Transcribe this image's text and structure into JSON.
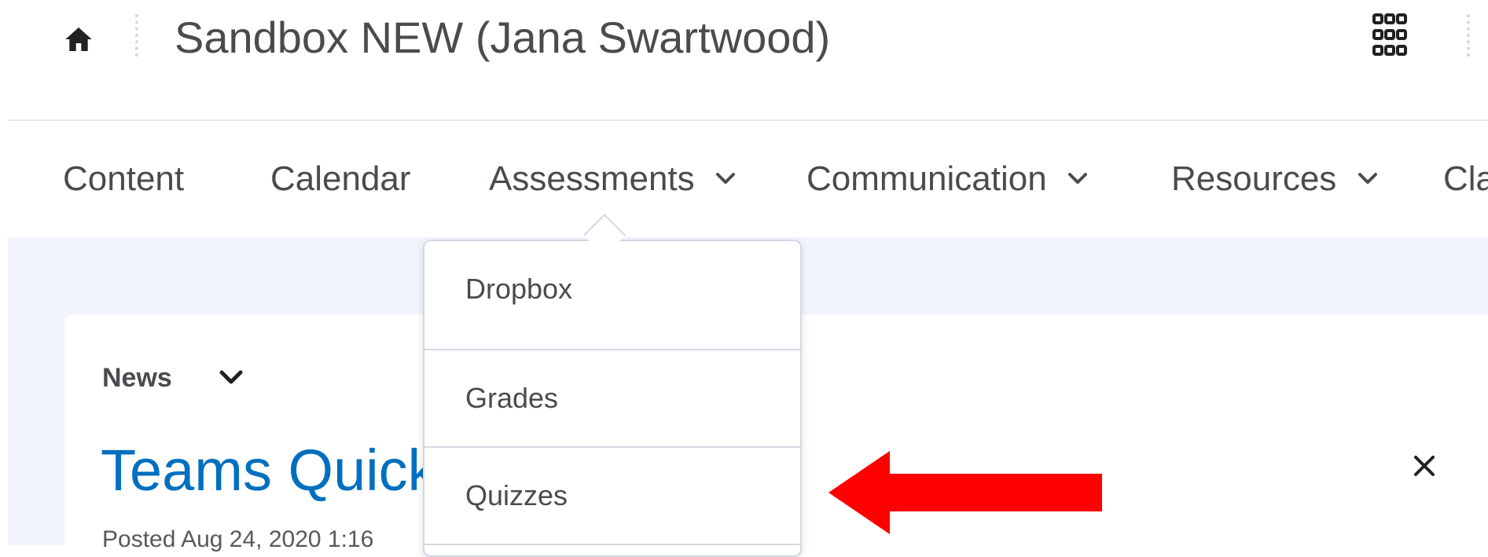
{
  "header": {
    "home_icon": "home-icon",
    "title": "Sandbox NEW (Jana Swartwood)",
    "apps_icon": "grid-icon"
  },
  "nav": {
    "items": [
      {
        "label": "Content",
        "has_chevron": false
      },
      {
        "label": "Calendar",
        "has_chevron": false
      },
      {
        "label": "Assessments",
        "has_chevron": true
      },
      {
        "label": "Communication",
        "has_chevron": true
      },
      {
        "label": "Resources",
        "has_chevron": true
      },
      {
        "label": "Cla",
        "has_chevron": false
      }
    ],
    "chevron_icon": "chevron-down-icon"
  },
  "dropdown": {
    "items": [
      {
        "label": "Dropbox"
      },
      {
        "label": "Grades"
      },
      {
        "label": "Quizzes"
      }
    ]
  },
  "news": {
    "label": "News",
    "title": "Teams Quick",
    "posted": "Posted Aug 24, 2020 1:16",
    "close_icon": "close-icon"
  },
  "annotation": {
    "arrow_color": "#ff0000",
    "arrow_direction": "left"
  },
  "colors": {
    "text": "#494c4e",
    "link_blue": "#006fbf",
    "page_bg": "#f1f5fb",
    "border": "#d3d9e3"
  }
}
